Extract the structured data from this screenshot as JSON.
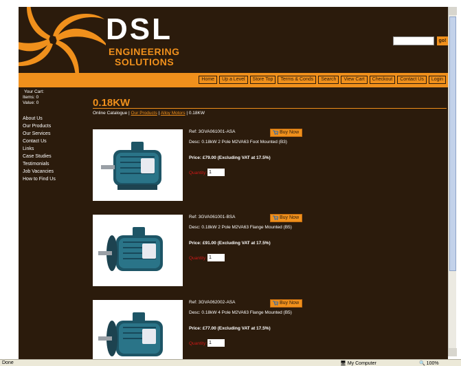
{
  "brand": {
    "name": "DSL",
    "sub1": "ENGINEERING",
    "sub2": "SOLUTIONS",
    "orange": "#f0901c",
    "background": "#2b1b0c"
  },
  "search": {
    "placeholder": "",
    "go_label": "go!"
  },
  "nav": [
    "Home",
    "Up a Level",
    "Store Top",
    "Terms & Conds",
    "Search",
    "View Cart",
    "Checkout",
    "Contact Us",
    "Login"
  ],
  "cart": {
    "title": "Your Cart:",
    "items": "Items: 0",
    "value": "Value: 0"
  },
  "sidebar": [
    "About Us",
    "Our Products",
    "Our Services",
    "Contact Us",
    "Links",
    "Case Studies",
    "Testimonials",
    "Job Vacancies",
    "How to Find Us"
  ],
  "page": {
    "title": "0.18KW",
    "breadcrumb": {
      "lead": "Online Catalogue |",
      "link1": "Our Products",
      "sep": "|",
      "link2": "Alloy Motors",
      "current": "| 0.18KW"
    }
  },
  "products": [
    {
      "ref": "Ref: 3GVA061001-ASA",
      "desc": "Desc: 0.18kW 2 Pole M2VA63 Foot Mounted (B3)",
      "price": "Price: £79.00",
      "vat": "(Excluding VAT at 17.5%)",
      "qty_label": "Quantity:",
      "qty": "1",
      "buy_label": "Buy Now"
    },
    {
      "ref": "Ref: 3GVA061001-BSA",
      "desc": "Desc: 0.18kW 2 Pole M2VA63 Flange Mounted (B5)",
      "price": "Price: £91.00",
      "vat": "(Excluding VAT at 17.5%)",
      "qty_label": "Quantity:",
      "qty": "1",
      "buy_label": "Buy Now"
    },
    {
      "ref": "Ref: 3GVA062002-ASA",
      "desc": "Desc: 0.18kW 4 Pole M2VA63 Flange Mounted (B5)",
      "price": "Price: £77.00",
      "vat": "(Excluding VAT at 17.5%)",
      "qty_label": "Quantity:",
      "qty": "1",
      "buy_label": "Buy Now"
    }
  ],
  "status": {
    "left": "Done",
    "zone": "My Computer",
    "zoom": "100%"
  }
}
